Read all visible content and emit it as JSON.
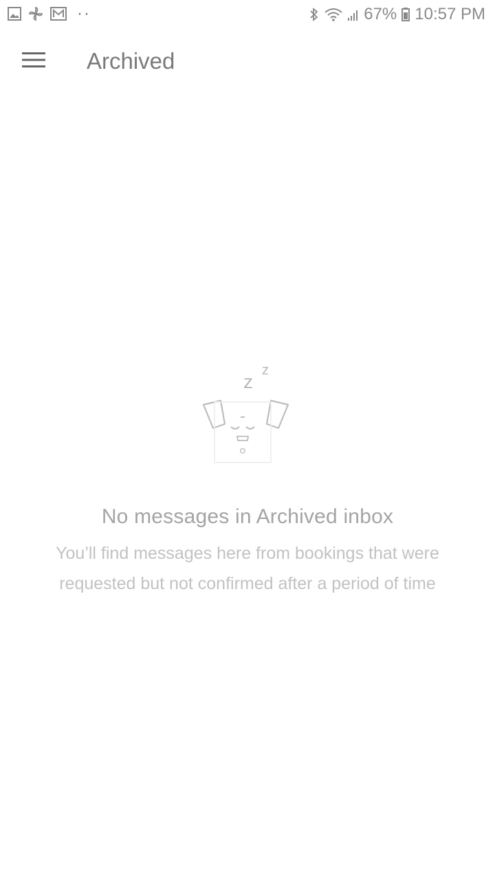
{
  "status_bar": {
    "left_icons": [
      "gallery-icon",
      "pinwheel-icon",
      "mail-icon"
    ],
    "dots": "··",
    "battery_percent": "67%",
    "time": "10:57 PM"
  },
  "app_bar": {
    "title": "Archived",
    "menu_icon": "hamburger-menu-icon"
  },
  "empty_state": {
    "illustration": "sleeping-dog-icon",
    "title": "No messages in Archived inbox",
    "description": "You’ll find messages here from bookings that were requested but not confirmed after a period of time"
  }
}
